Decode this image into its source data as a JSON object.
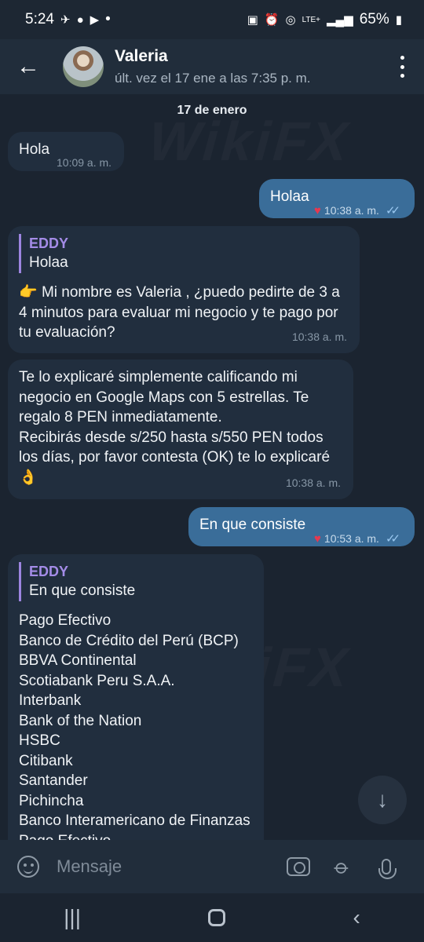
{
  "status_bar": {
    "time": "5:24",
    "app_icons": [
      "telegram-icon",
      "user-icon",
      "youtube-icon"
    ],
    "dot": "•",
    "system_icons": [
      "sim-icon",
      "alarm-icon",
      "hotspot-icon",
      "lte-signal-icon"
    ],
    "network": "LTE+",
    "battery": "65%"
  },
  "header": {
    "contact_name": "Valeria",
    "last_seen": "últ. vez el 17 ene a las 7:35 p. m."
  },
  "chat": {
    "date_chip": "17 de enero",
    "watermark": "WikiFX",
    "messages": [
      {
        "text": "Hola",
        "time": "10:09 a. m."
      },
      {
        "text": "Holaa",
        "time": "10:38 a. m.",
        "reaction": "♥"
      },
      {
        "reply_name": "EDDY",
        "reply_text": "Holaa",
        "emoji": "👉",
        "text": " Mi nombre es Valeria , ¿puedo pedirte de 3 a 4 minutos para evaluar mi negocio y te pago por tu evaluación?",
        "time": "10:38 a. m."
      },
      {
        "lines": [
          "Te lo explicaré simplemente calificando mi",
          "negocio en  Google Maps con 5 estrellas. Te",
          "regalo 8 PEN inmediatamente.",
          "Recibirás desde s/250 hasta s/550 PEN todos",
          "los días,  por favor contesta (OK) te lo explicaré"
        ],
        "emoji": "👌",
        "time": "10:38 a. m."
      },
      {
        "text": "En que consiste",
        "time": "10:53 a. m.",
        "reaction": "♥"
      },
      {
        "reply_name": "EDDY",
        "reply_text": "En que consiste",
        "lines": [
          "Pago Efectivo",
          "Banco de Crédito del Perú    (BCP)",
          "BBVA Continental",
          "Scotiabank Peru S.A.A.",
          "Interbank",
          "Bank of the Nation",
          "HSBC",
          "Citibank",
          "Santander",
          "Pichincha",
          "Banco Interamericano de Finanzas",
          "Pago Efectivo"
        ]
      }
    ]
  },
  "input": {
    "placeholder": "Mensaje"
  },
  "nav": {
    "recents": "|||",
    "back": "‹"
  }
}
